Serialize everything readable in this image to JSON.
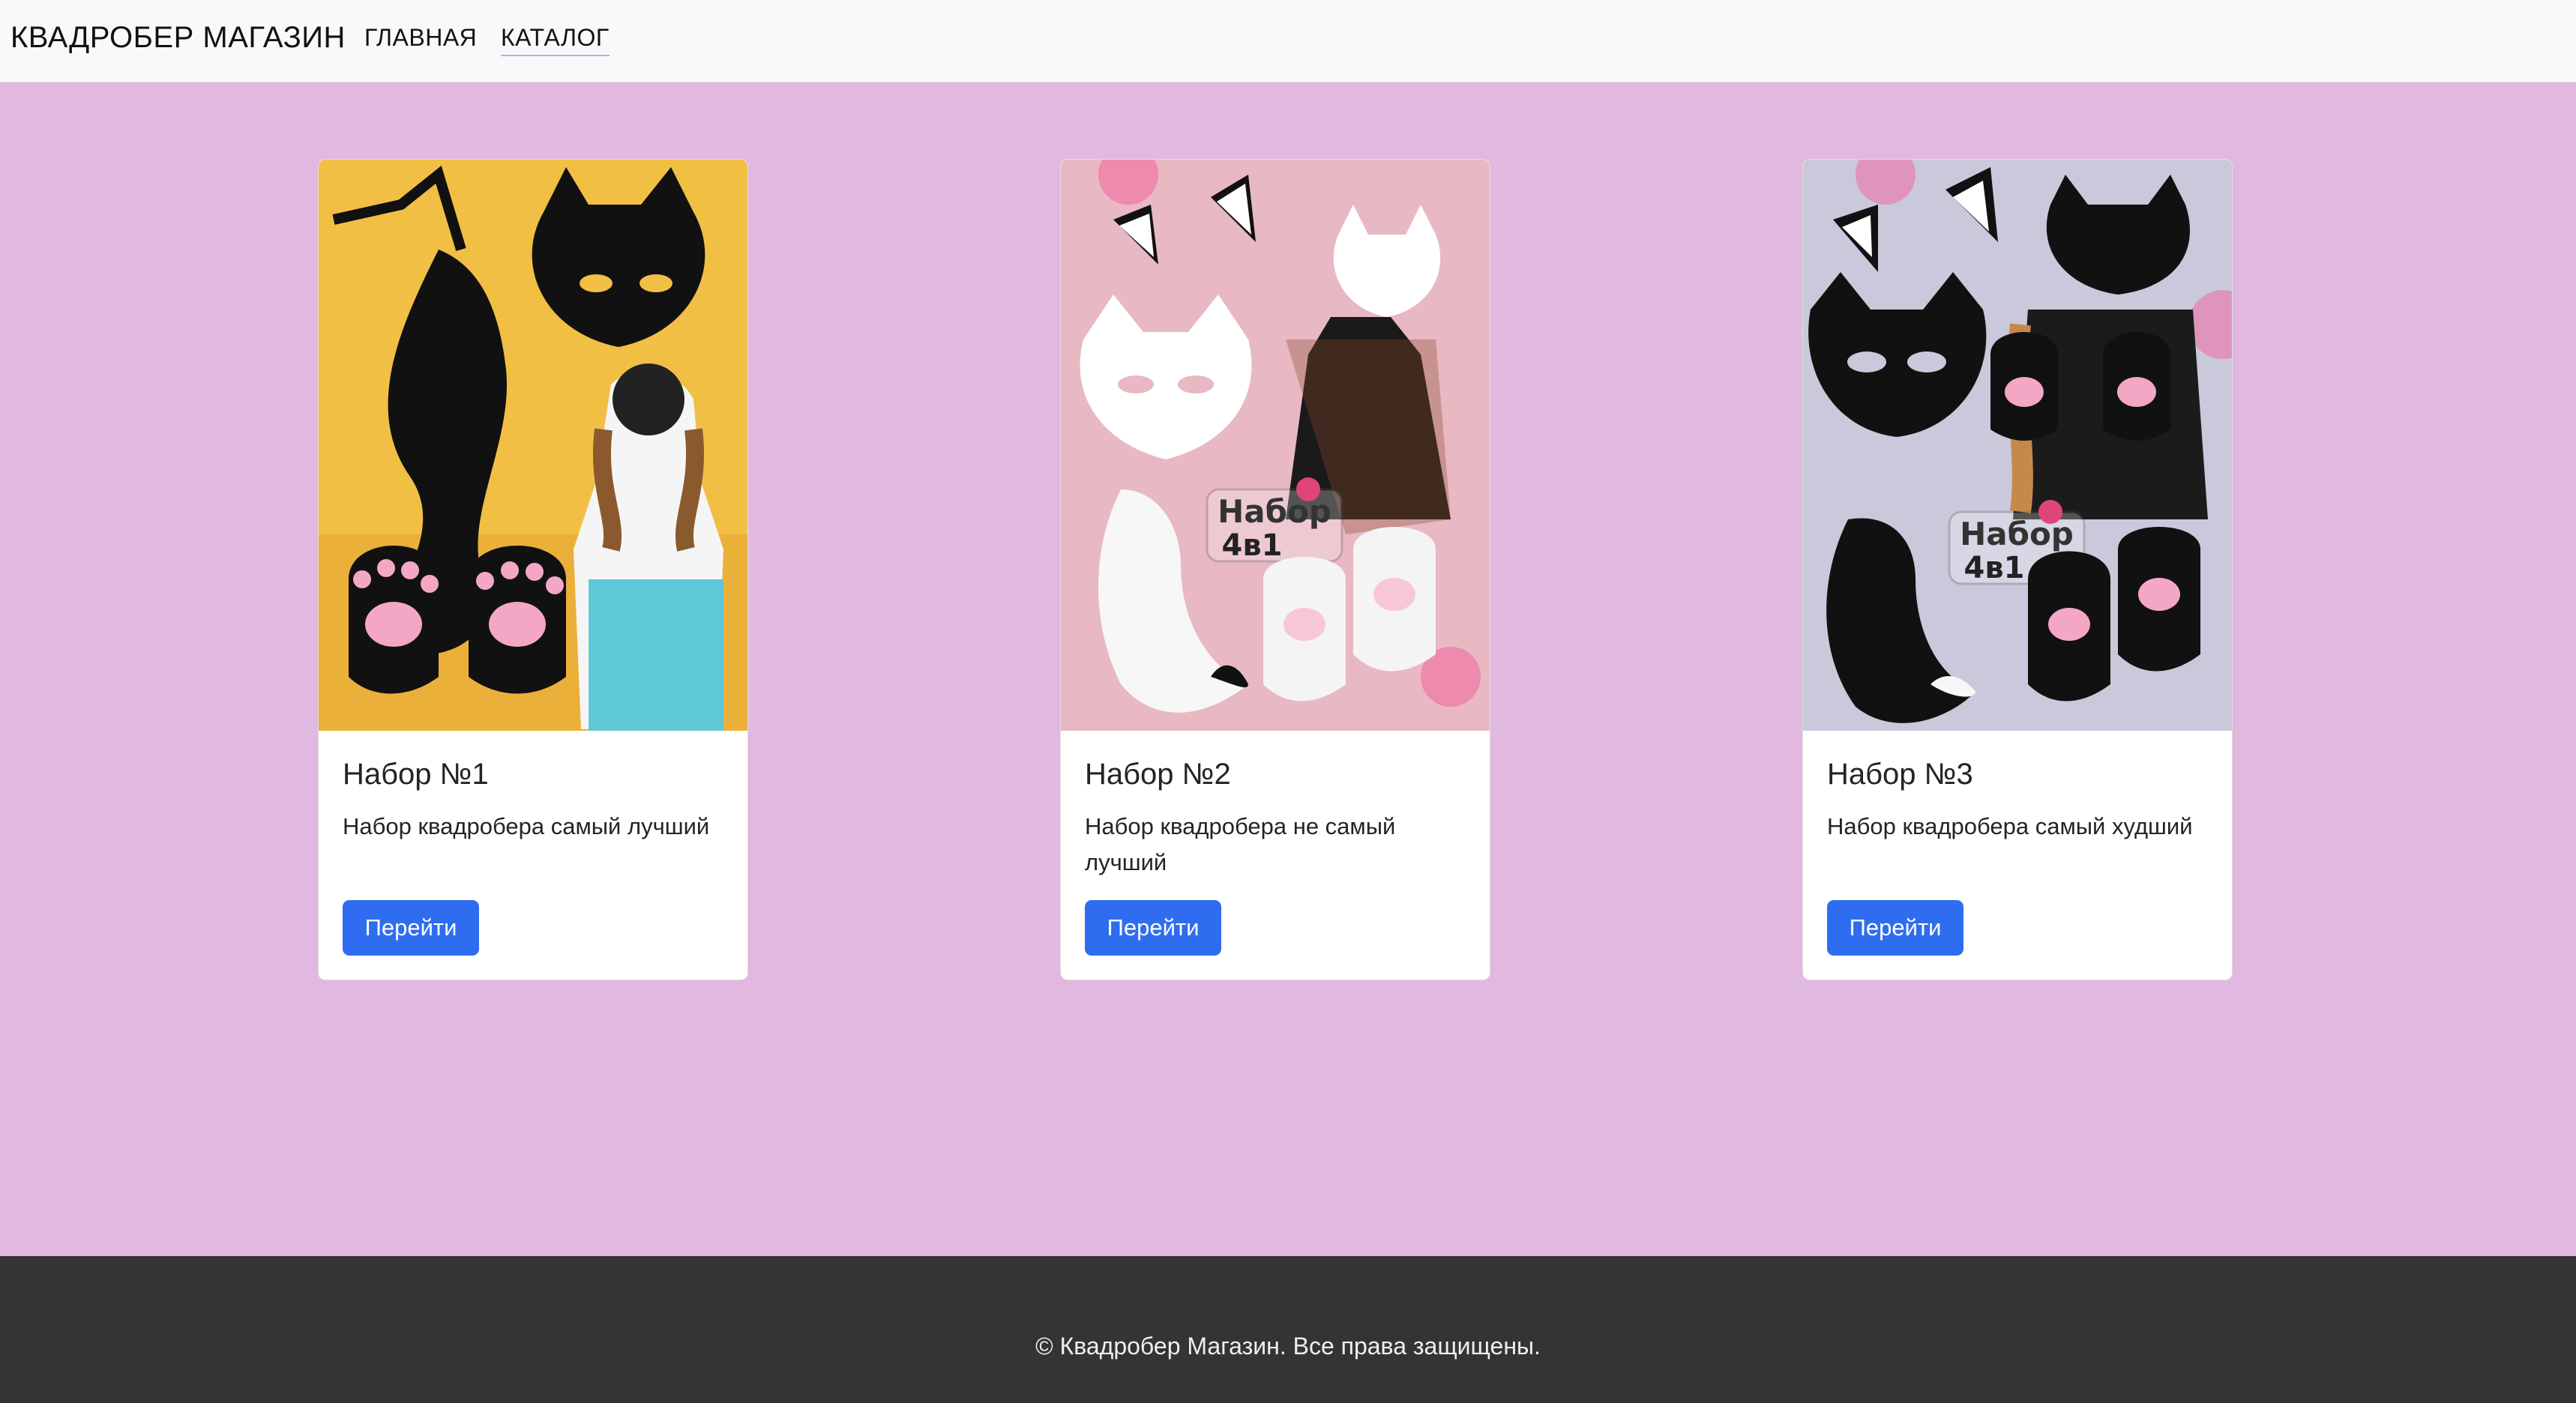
{
  "navbar": {
    "brand": "КВАДРОБЕР МАГАЗИН",
    "links": [
      {
        "label": "ГЛАВНАЯ"
      },
      {
        "label": "КАТАЛОГ"
      }
    ]
  },
  "products": [
    {
      "title": "Набор №1",
      "description": "Набор квадробера самый лучший",
      "button_label": "Перейти",
      "image_background": "#f2bf45"
    },
    {
      "title": "Набор №2",
      "description": "Набор квадробера не самый лучший",
      "button_label": "Перейти",
      "image_badge_line1": "Набор",
      "image_badge_line2": "4в1",
      "image_background": "#e8b8c3"
    },
    {
      "title": "Набор №3",
      "description": "Набор квадробера самый худший",
      "button_label": "Перейти",
      "image_badge_line1": "Набор",
      "image_badge_line2": "4в1",
      "image_background": "#c9c9db"
    }
  ],
  "footer": {
    "text": "© Квадробер Магазин. Все права защищены."
  },
  "colors": {
    "page_background": "#e0b8e0",
    "navbar_background": "#f8f9fa",
    "footer_background": "#343434",
    "button_primary": "#2f6df0"
  }
}
